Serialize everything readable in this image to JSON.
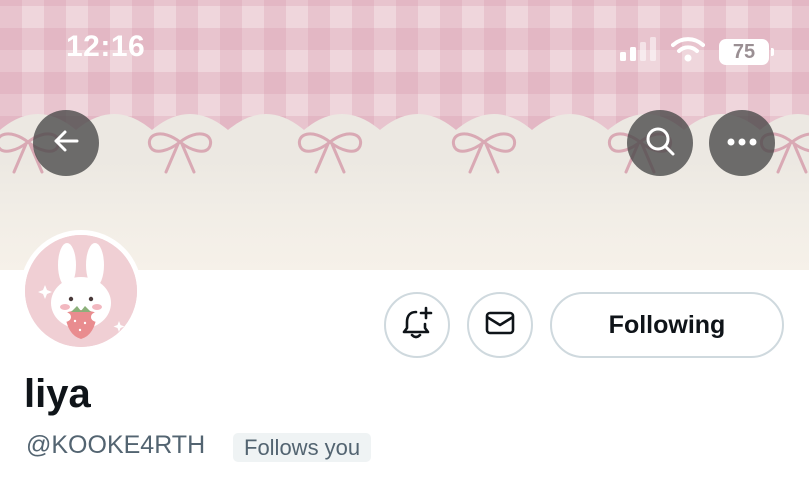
{
  "status_bar": {
    "time": "12:16",
    "battery_level": "75",
    "signal_icon": "cellular-signal-icon",
    "wifi_icon": "wifi-icon"
  },
  "nav": {
    "back_icon": "arrow-left-icon",
    "search_icon": "search-icon",
    "more_icon": "more-horizontal-icon"
  },
  "profile": {
    "display_name": "liya",
    "handle": "@KOOKE4RTH",
    "follows_you_label": "Follows you"
  },
  "actions": {
    "notify_icon": "bell-plus-icon",
    "message_icon": "envelope-icon",
    "following_label": "Following"
  },
  "colors": {
    "banner_pink": "#efd6dc",
    "banner_cream": "#f1ede6",
    "nav_button_bg": "#484848",
    "text_primary": "#0f1419",
    "text_secondary": "#536471",
    "button_border": "#cfd9de",
    "badge_bg": "#eff3f4"
  }
}
